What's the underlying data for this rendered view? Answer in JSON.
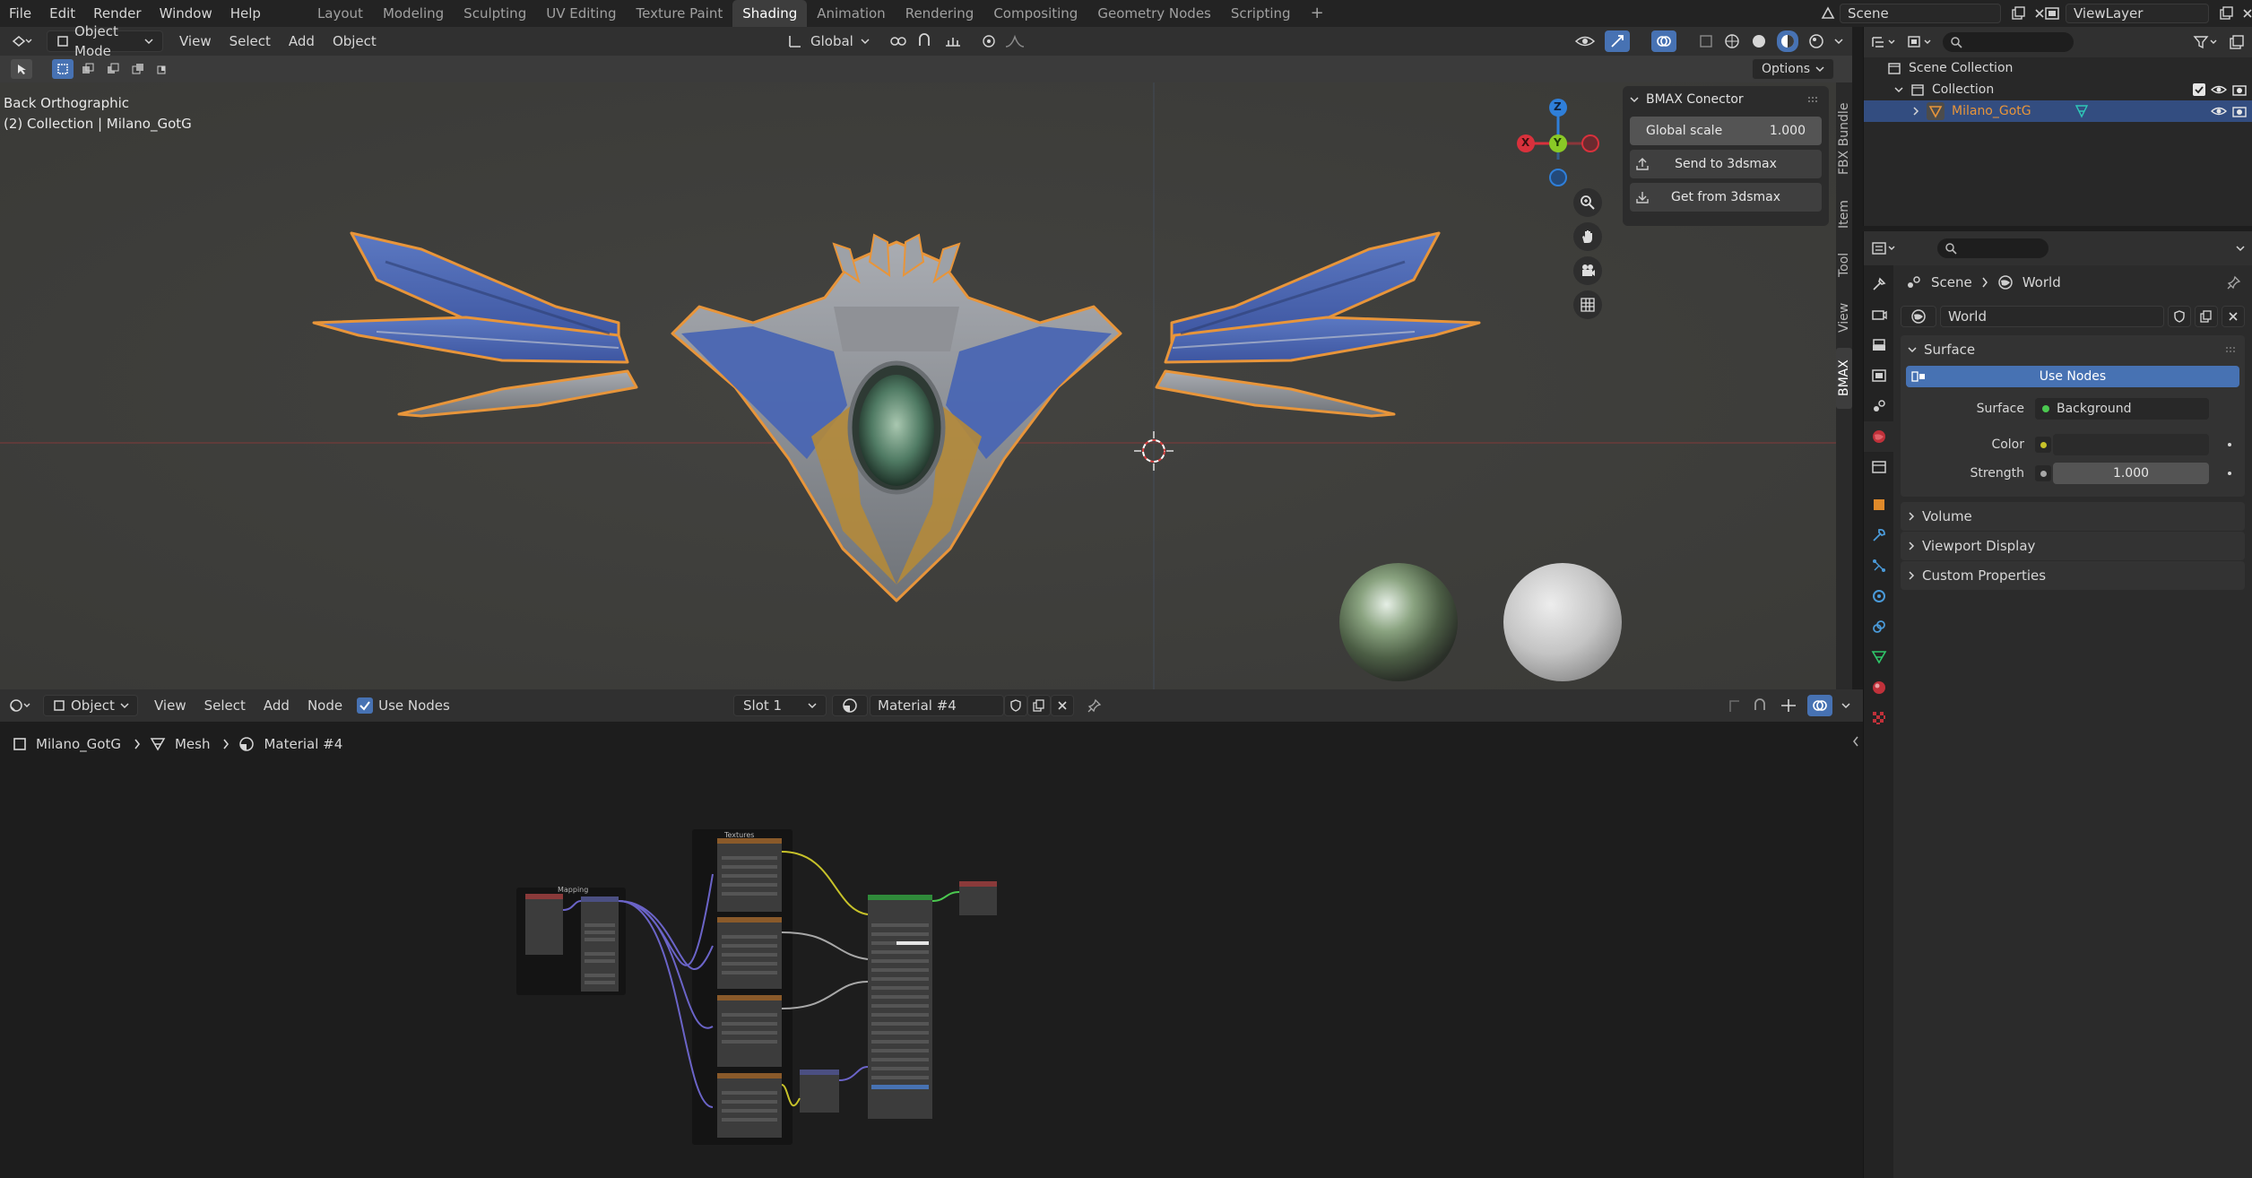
{
  "topbar": {
    "menus": [
      "File",
      "Edit",
      "Render",
      "Window",
      "Help"
    ],
    "workspaces": [
      "Layout",
      "Modeling",
      "Sculpting",
      "UV Editing",
      "Texture Paint",
      "Shading",
      "Animation",
      "Rendering",
      "Compositing",
      "Geometry Nodes",
      "Scripting"
    ],
    "active_workspace": "Shading",
    "add_workspace": "+",
    "scene": "Scene",
    "view_layer": "ViewLayer"
  },
  "viewport": {
    "mode": "Object Mode",
    "menus": [
      "View",
      "Select",
      "Add",
      "Object"
    ],
    "orientation": "Global",
    "options_label": "Options",
    "view_name": "Back Orthographic",
    "collection_info": "(2) Collection | Milano_GotG",
    "gizmo": {
      "x": "X",
      "y": "Y",
      "z": "Z"
    }
  },
  "bmax_panel": {
    "title": "BMAX Conector",
    "global_scale_label": "Global scale",
    "global_scale_value": "1.000",
    "send_label": "Send to 3dsmax",
    "get_label": "Get from 3dsmax"
  },
  "sidebar_tabs": [
    "FBX Bundle",
    "Item",
    "Tool",
    "View",
    "BMAX"
  ],
  "node_editor": {
    "object_label": "Object",
    "menus": [
      "View",
      "Select",
      "Add",
      "Node"
    ],
    "use_nodes_label": "Use Nodes",
    "slot": "Slot 1",
    "material": "Material #4",
    "breadcrumb": [
      "Milano_GotG",
      "Mesh",
      "Material #4"
    ],
    "frame_textures": "Textures",
    "frame_mapping": "Mapping"
  },
  "outliner": {
    "scene_collection": "Scene Collection",
    "collection": "Collection",
    "object": "Milano_GotG"
  },
  "properties": {
    "breadcrumb_scene": "Scene",
    "breadcrumb_world": "World",
    "world_name": "World",
    "surface_section": "Surface",
    "use_nodes_button": "Use Nodes",
    "surface_label": "Surface",
    "surface_value": "Background",
    "color_label": "Color",
    "strength_label": "Strength",
    "strength_value": "1.000",
    "sections": [
      "Volume",
      "Viewport Display",
      "Custom Properties"
    ]
  },
  "colors": {
    "accent": "#4772b3",
    "selected_outline": "#e8953a",
    "axis_x": "#d9313c",
    "axis_y": "#8ac926",
    "axis_z": "#2f7fd9"
  }
}
